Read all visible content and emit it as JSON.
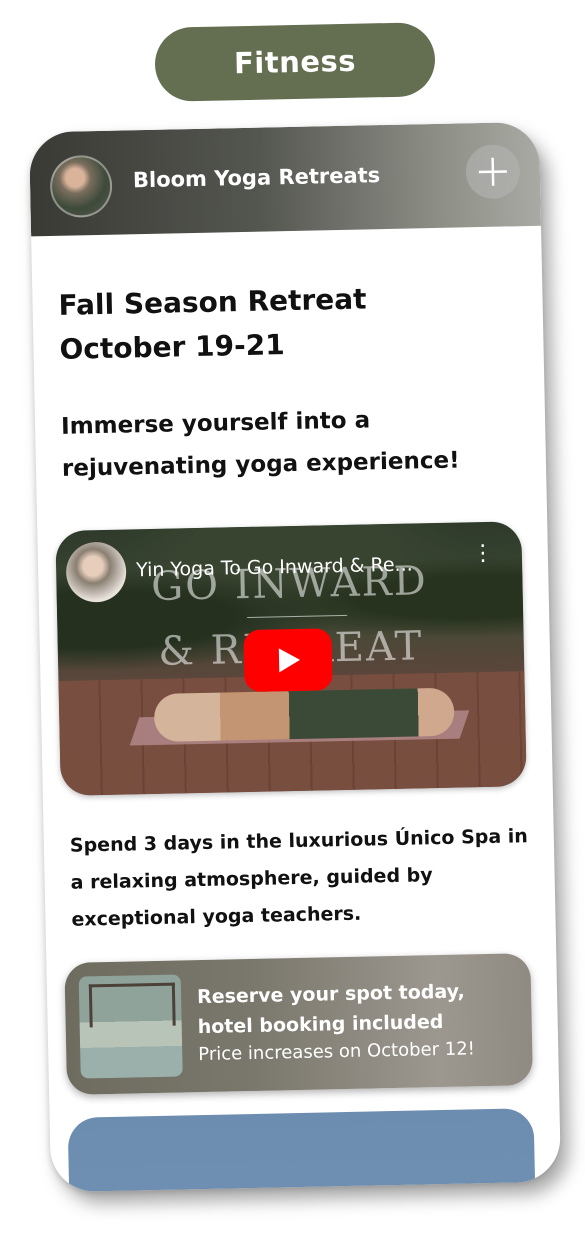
{
  "category_pill": "Fitness",
  "header": {
    "brand": "Bloom Yoga Retreats",
    "add_icon": "plus-icon"
  },
  "main": {
    "title_line1": "Fall Season Retreat",
    "title_line2": "October 19-21",
    "tagline": "Immerse yourself into a rejuvenating yoga experience!",
    "video": {
      "title": "Yin Yoga To Go Inward & Re...",
      "overlay_line1": "GO INWARD",
      "overlay_line2": "& RETREAT",
      "play_icon": "play-icon"
    },
    "description": "Spend 3 days in the luxurious Único Spa in a relaxing atmosphere, guided by exceptional yoga teachers.",
    "promo": {
      "title": "Reserve your spot today, hotel booking included",
      "subtitle": "Price increases on October 12!"
    }
  },
  "colors": {
    "pill": "#646e51",
    "play": "#ff0000"
  }
}
